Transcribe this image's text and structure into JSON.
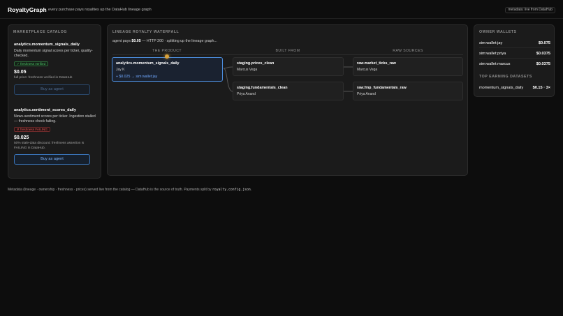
{
  "header": {
    "brand": "RoyaltyGraph",
    "tagline": "every purchase pays royalties up the DataHub lineage graph",
    "meta_pill": "metadata: live from DataHub"
  },
  "catalog": {
    "title": "MARKETPLACE CATALOG",
    "items": [
      {
        "name": "analytics.momentum_signals_daily",
        "description": "Daily momentum signal scores per ticker, quality-checked.",
        "badge": "✓ freshness verified",
        "price": "$0.05",
        "price_note": "full price: freshness verified in DataHub",
        "button": "Buy as agent"
      },
      {
        "name": "analytics.sentiment_scores_daily",
        "description": "News-sentiment scores per ticker. Ingestion stalled — freshness check failing.",
        "badge": "✗ freshness FAILING",
        "price": "$0.025",
        "price_note": "50% stale-data discount: freshness assertion is FAILING in DataHub.",
        "button": "Buy as agent"
      }
    ]
  },
  "waterfall": {
    "title": "LINEAGE ROYALTY WATERFALL",
    "pays_prefix": "agent pays",
    "pays_amount": "$0.05",
    "pays_suffix": "— HTTP 200 · splitting up the lineage graph...",
    "columns": [
      "THE PRODUCT",
      "BUILT FROM",
      "RAW SOURCES"
    ],
    "product": {
      "name": "analytics.momentum_signals_daily",
      "owner": "Jay K",
      "royalty": "+ $0.025 → sim:wallet:jay"
    },
    "built_from": [
      {
        "name": "staging.prices_clean",
        "owner": "Marcus Vega"
      },
      {
        "name": "staging.fundamentals_clean",
        "owner": "Priya Anand"
      }
    ],
    "raw_sources": [
      {
        "name": "raw.market_ticks_raw",
        "owner": "Marcus Vega"
      },
      {
        "name": "raw.fmp_fundamentals_raw",
        "owner": "Priya Anand"
      }
    ]
  },
  "wallets": {
    "title": "OWNER WALLETS",
    "items": [
      {
        "name": "sim:wallet:jay",
        "amount": "$0.075"
      },
      {
        "name": "sim:wallet:priya",
        "amount": "$0.0375"
      },
      {
        "name": "sim:wallet:marcus",
        "amount": "$0.0375"
      }
    ],
    "top_title": "TOP EARNING DATASETS",
    "top": [
      {
        "name": "momentum_signals_daily",
        "value": "$0.15 · 3×"
      }
    ]
  },
  "footer": {
    "text": "Metadata (lineage · ownership · freshness · prices) served live from the catalog — DataHub is the source of truth. Payments split by",
    "code": "royalty.config.json",
    "end": "."
  },
  "colors": {
    "accent": "#4d8fe0",
    "ok": "#4fc46a",
    "bad": "#e05a5a",
    "coin": "#d9a13a"
  }
}
